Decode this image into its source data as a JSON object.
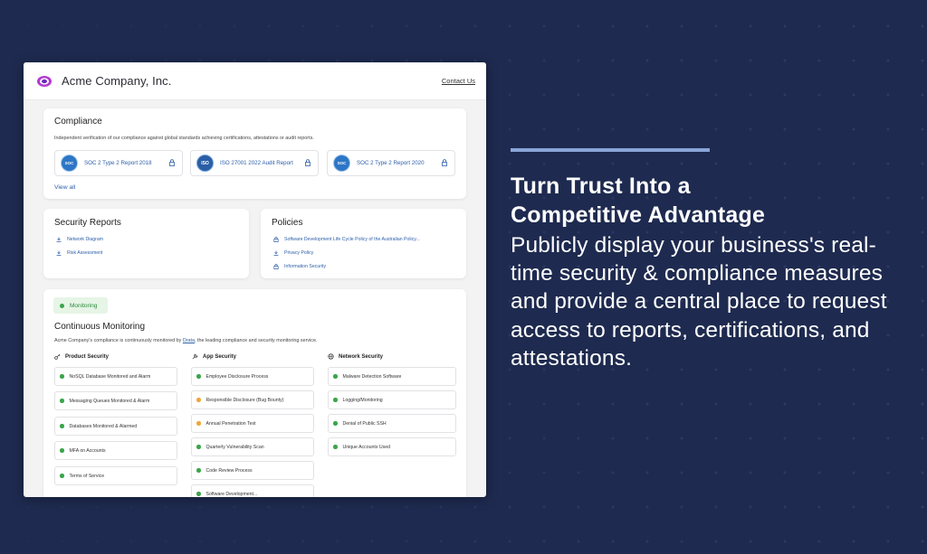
{
  "header": {
    "brand": "Acme Company, Inc.",
    "contact": "Contact Us"
  },
  "compliance": {
    "title": "Compliance",
    "description": "Independent verification of our compliance against global standards achieving certifications, attestations or audit reports.",
    "certs": [
      {
        "label": "SOC 2 Type 2 Report 2018",
        "badge": "AICPA SOC"
      },
      {
        "label": "ISO 27001 2022 Audit Report",
        "badge": "ISO"
      },
      {
        "label": "SOC 2 Type 2 Report 2020",
        "badge": "AICPA SOC"
      }
    ],
    "view_all": "View all"
  },
  "reports": {
    "title": "Security Reports",
    "items": [
      "Network Diagram",
      "Risk Assessment"
    ]
  },
  "policies": {
    "title": "Policies",
    "items": [
      "Software Development Life Cycle Policy of the Australian Policy...",
      "Privacy Policy",
      "Information Security"
    ]
  },
  "monitoring": {
    "chip": "Monitoring",
    "title": "Continuous Monitoring",
    "desc_prefix": "Acme Company's compliance is continuously monitored by ",
    "desc_link": "Drata",
    "desc_suffix": ", the leading compliance and security monitoring service.",
    "columns": [
      {
        "title": "Product Security",
        "icon": "key-icon",
        "items": [
          {
            "label": "NoSQL Database Monitored and Alarm",
            "status": "green"
          },
          {
            "label": "Messaging Queues Monitored & Alarm",
            "status": "green"
          },
          {
            "label": "Databases Monitored & Alarmed",
            "status": "green"
          },
          {
            "label": "MFA on Accounts",
            "status": "green"
          },
          {
            "label": "Terms of Service",
            "status": "green"
          }
        ]
      },
      {
        "title": "App Security",
        "icon": "wrench-icon",
        "items": [
          {
            "label": "Employee Disclosure Process",
            "status": "green"
          },
          {
            "label": "Responsible Disclosure (Bug Bounty)",
            "status": "orange"
          },
          {
            "label": "Annual Penetration Test",
            "status": "orange"
          },
          {
            "label": "Quarterly Vulnerability Scan",
            "status": "green"
          },
          {
            "label": "Code Review Process",
            "status": "green"
          },
          {
            "label": "Software Development...",
            "status": "green"
          }
        ]
      },
      {
        "title": "Network Security",
        "icon": "globe-icon",
        "items": [
          {
            "label": "Malware Detection Software",
            "status": "green"
          },
          {
            "label": "Logging/Monitoring",
            "status": "green"
          },
          {
            "label": "Denial of Public SSH",
            "status": "green"
          },
          {
            "label": "Unique Accounts Used",
            "status": "green"
          }
        ]
      }
    ]
  },
  "hero": {
    "title_line1": "Turn Trust Into a",
    "title_line2": "Competitive Advantage",
    "body": "Publicly display your business's real-time security & compliance measures and provide a central place to request access to reports, certifications, and attestations."
  },
  "colors": {
    "background": "#1e2a4f",
    "accent_bar": "#8aa5d8",
    "link": "#2d5fa8",
    "status_green": "#3aa54a",
    "status_orange": "#f0a63a"
  }
}
